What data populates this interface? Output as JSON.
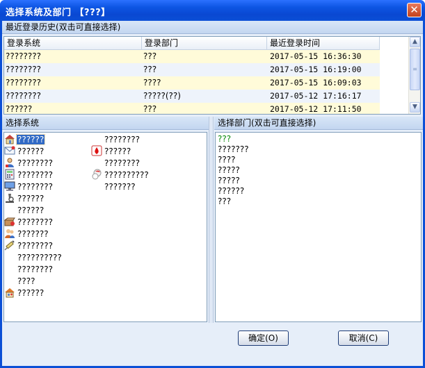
{
  "window": {
    "title": "选择系统及部门 【???】",
    "close_glyph": "✕"
  },
  "history": {
    "header": "最近登录历史(双击可直接选择)",
    "columns": [
      "登录系统",
      "登录部门",
      "最近登录时间"
    ],
    "rows": [
      {
        "system": "????????",
        "dept": "???",
        "time": "2017-05-15 16:36:30"
      },
      {
        "system": "????????",
        "dept": "???",
        "time": "2017-05-15 16:19:00"
      },
      {
        "system": "????????",
        "dept": "????",
        "time": "2017-05-15 16:09:03"
      },
      {
        "system": "????????",
        "dept": "?????(??)",
        "time": "2017-05-12 17:16:17"
      },
      {
        "system": "??????",
        "dept": "???",
        "time": "2017-05-12 17:11:50"
      }
    ]
  },
  "systems": {
    "header": "选择系统",
    "left_items": [
      {
        "label": "??????",
        "icon": "home-icon",
        "selected": true
      },
      {
        "label": "??????",
        "icon": "mail-icon"
      },
      {
        "label": "????????",
        "icon": "user-icon"
      },
      {
        "label": "????????",
        "icon": "calculator-icon"
      },
      {
        "label": "????????",
        "icon": "monitor-icon"
      },
      {
        "label": "??????",
        "icon": "microscope-icon"
      },
      {
        "label": "??????",
        "icon": ""
      },
      {
        "label": "????????",
        "icon": "box-icon"
      },
      {
        "label": "???????",
        "icon": "people-icon"
      },
      {
        "label": "????????",
        "icon": "syringe-icon"
      },
      {
        "label": "??????????",
        "icon": ""
      },
      {
        "label": "????????",
        "icon": ""
      },
      {
        "label": "????",
        "icon": ""
      },
      {
        "label": "??????",
        "icon": "house-icon"
      }
    ],
    "right_items": [
      {
        "label": "????????",
        "icon": ""
      },
      {
        "label": "??????",
        "icon": "blood-drop-icon"
      },
      {
        "label": "????????",
        "icon": ""
      },
      {
        "label": "??????????",
        "icon": "pills-icon"
      },
      {
        "label": "???????",
        "icon": ""
      }
    ]
  },
  "departments": {
    "header": "选择部门(双击可直接选择)",
    "items": [
      "???",
      "???????",
      "????",
      "?????",
      "?????",
      "??????",
      "???"
    ]
  },
  "buttons": {
    "ok": "确定(O)",
    "cancel": "取消(C)"
  }
}
